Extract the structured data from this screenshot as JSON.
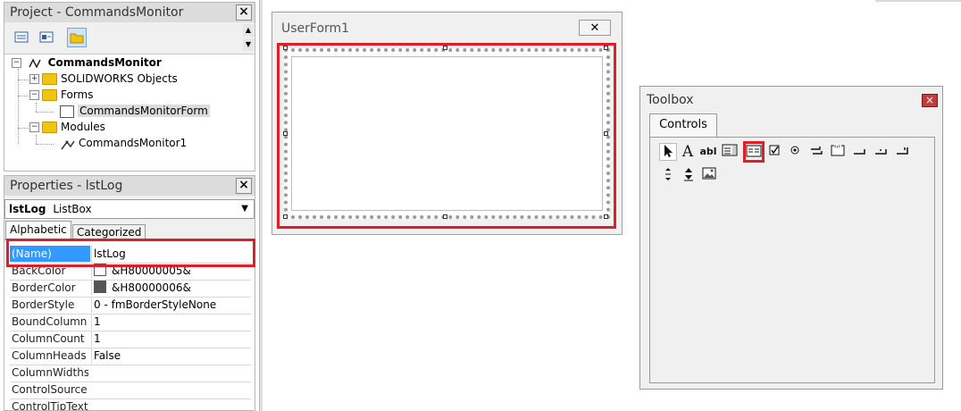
{
  "project": {
    "title": "Project - CommandsMonitor",
    "close": "×",
    "toolbar": {
      "buttons": [
        {
          "icon": "view-code-icon"
        },
        {
          "icon": "view-object-icon"
        },
        {
          "icon": "toggle-folders-icon"
        }
      ]
    },
    "tree": {
      "root": "CommandsMonitor",
      "solidworks_objects": "SOLIDWORKS Objects",
      "forms": "Forms",
      "form_item": "CommandsMonitorForm",
      "modules": "Modules",
      "module_item": "CommandsMonitor1"
    }
  },
  "properties": {
    "title": "Properties - lstLog",
    "close": "×",
    "object_name": "lstLog",
    "object_type": "ListBox",
    "tabs": [
      "Alphabetic",
      "Categorized"
    ],
    "rows": [
      {
        "name": "(Name)",
        "value": "lstLog"
      },
      {
        "name": "BackColor",
        "value": "&H80000005&",
        "swatch": "#ffffff"
      },
      {
        "name": "BorderColor",
        "value": "&H80000006&",
        "swatch": "#555555"
      },
      {
        "name": "BorderStyle",
        "value": "0 - fmBorderStyleNone"
      },
      {
        "name": "BoundColumn",
        "value": "1"
      },
      {
        "name": "ColumnCount",
        "value": "1"
      },
      {
        "name": "ColumnHeads",
        "value": "False"
      },
      {
        "name": "ColumnWidths",
        "value": ""
      },
      {
        "name": "ControlSource",
        "value": ""
      },
      {
        "name": "ControlTipText",
        "value": ""
      }
    ]
  },
  "userform": {
    "title": "UserForm1",
    "close": "✕"
  },
  "toolbox": {
    "title": "Toolbox",
    "close": "×",
    "tab": "Controls",
    "tools_row1": [
      "pointer-icon",
      "label-icon",
      "textbox-icon",
      "combobox-icon",
      "listbox-icon",
      "checkbox-icon",
      "optionbutton-icon",
      "togglebutton-icon",
      "frame-icon",
      "commandbutton-icon",
      "tabstrip-icon",
      "multipage-icon"
    ],
    "tools_row2": [
      "scrollbar-icon",
      "spinbutton-icon",
      "image-icon"
    ],
    "glyphs": {
      "label": "A",
      "textbox": "abl"
    }
  },
  "colors": {
    "highlight": "#e11d2a",
    "selection": "#3399ff"
  }
}
